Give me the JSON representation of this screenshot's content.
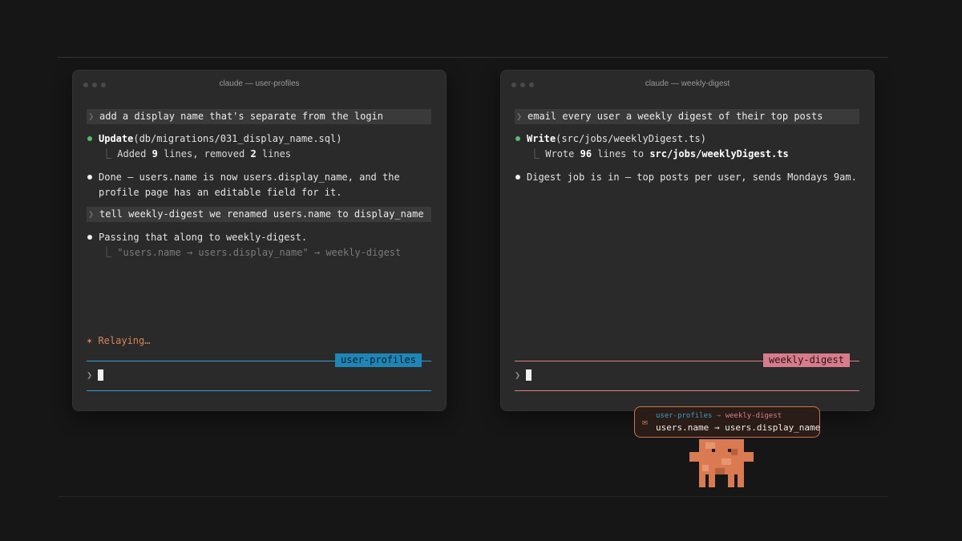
{
  "colors": {
    "background": "#161616",
    "window": "#2a2a2a",
    "user_profiles_accent": "#2f9fd4",
    "weekly_digest_accent": "#d97f8b",
    "relay_accent": "#d7845a",
    "success_green": "#5db872"
  },
  "left_window": {
    "title": "claude — user-profiles",
    "prompt1": "add a display name that's separate from the login",
    "update_tool": "Update",
    "update_args": "(db/migrations/031_display_name.sql)",
    "added_prefix": "Added ",
    "added_count": "9",
    "added_mid": " lines, removed ",
    "removed_count": "2",
    "added_suffix": " lines",
    "done_line1": "Done — users.name is now users.display_name, and the",
    "done_line2": "profile page has an editable field for it.",
    "prompt2": "tell weekly-digest we renamed users.name to display_name",
    "passing": "Passing that along to weekly-digest.",
    "relay_note": "\"users.name → users.display_name\" → weekly-digest",
    "status": "✶ Relaying…",
    "tag": "user-profiles",
    "input_prompt": "❯"
  },
  "right_window": {
    "title": "claude — weekly-digest",
    "prompt1": "email every user a weekly digest of their top posts",
    "write_tool": "Write",
    "write_args": "(src/jobs/weeklyDigest.ts)",
    "wrote_prefix": "Wrote ",
    "wrote_count": "96",
    "wrote_mid": " lines to ",
    "wrote_path": "src/jobs/weeklyDigest.ts",
    "digest_line": "Digest job is in — top posts per user, sends Mondays 9am.",
    "tag": "weekly-digest",
    "input_prompt": "❯"
  },
  "notification": {
    "icon": "envelope-icon",
    "icon_glyph": "✉",
    "from": "user-profiles",
    "arrow": " → ",
    "to": "weekly-digest",
    "message": "users.name → users.display_name"
  },
  "icons": {
    "chevron": "❯",
    "tree_branch": "⎿",
    "mascot": "pixel-crab-mascot-icon"
  }
}
